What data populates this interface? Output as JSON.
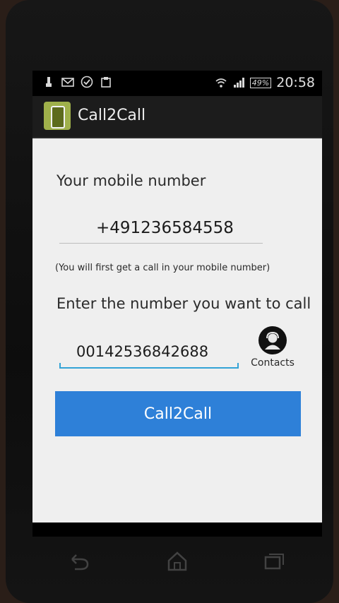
{
  "status_bar": {
    "icons_left": [
      "usb-icon",
      "mail-icon",
      "check-circle-icon",
      "clipboard-icon"
    ],
    "icons_right": [
      "wifi-icon",
      "signal-icon"
    ],
    "battery": "49%",
    "time": "20:58"
  },
  "action_bar": {
    "title": "Call2Call",
    "icon": "phone-app-icon"
  },
  "form": {
    "mobile_label": "Your mobile number",
    "mobile_value": "+491236584558",
    "hint": "(You will first get a call in your mobile number)",
    "call_label": "Enter the number you want to call",
    "call_value": "00142536842688",
    "contacts_label": "Contacts",
    "call_button": "Call2Call"
  },
  "nav": {
    "back": "back-icon",
    "home": "home-icon",
    "recents": "recents-icon"
  },
  "colors": {
    "accent": "#33a3d6",
    "button": "#2e80d8",
    "content_bg": "#efefef",
    "action_bar_bg": "#1c1c1c"
  }
}
